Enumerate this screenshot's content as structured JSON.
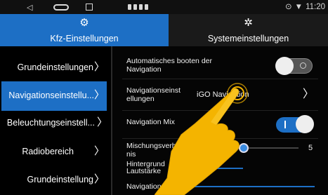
{
  "status_bar": {
    "time": "11:20"
  },
  "tabs": [
    {
      "label": "Kfz-Einstellungen",
      "icon": "gear-icon",
      "active": true
    },
    {
      "label": "Systemeinstellungen",
      "icon": "settings-cog-icon",
      "active": false
    }
  ],
  "sidebar": {
    "items": [
      {
        "label": "Grundeinstellungen",
        "active": false
      },
      {
        "label": "Navigationseinstellu...",
        "active": true
      },
      {
        "label": "Beleuchtungseinstell...",
        "active": false
      },
      {
        "label": "Radiobereich",
        "active": false
      },
      {
        "label": "Grundeinstellung",
        "active": false
      }
    ]
  },
  "content": {
    "auto_boot": {
      "label_line1": "Automatisches booten der",
      "label_line2": "Navigation",
      "enabled": false
    },
    "nav_settings": {
      "label_line1": "Navigationseinst",
      "label_line2": "ellungen",
      "value": "iGO Navigation"
    },
    "nav_mix": {
      "label": "Navigation Mix",
      "enabled": true
    },
    "mix_ratio": {
      "label_line1": "Mischungsverhält",
      "label_line2": "nis",
      "value": "5"
    },
    "bg_volume": {
      "label_line1": "Hintergrund",
      "label_line2": "Lautstärke"
    },
    "nav_volume": {
      "label": "Navigationslaut..."
    }
  },
  "colors": {
    "accent": "#1d6fc5",
    "hand": "#f4b400"
  }
}
